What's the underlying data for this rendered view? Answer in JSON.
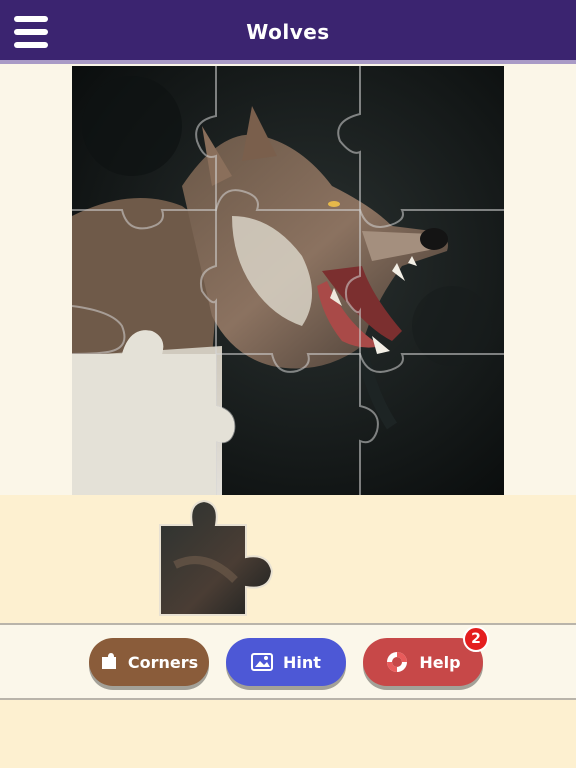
{
  "header": {
    "title": "Wolves"
  },
  "puzzle": {
    "grid_rows": 3,
    "grid_cols": 3,
    "image_subject": "wolf-photo"
  },
  "toolbar": {
    "corners_label": "Corners",
    "hint_label": "Hint",
    "help_label": "Help",
    "help_badge": "2"
  },
  "colors": {
    "header_bg": "#3b2470",
    "corners_btn": "#8a5c3a",
    "hint_btn": "#4d58d6",
    "help_btn": "#c74848",
    "badge": "#e41e1e",
    "tray_bg": "#fdf0d0",
    "page_bg": "#fbf6e8"
  }
}
